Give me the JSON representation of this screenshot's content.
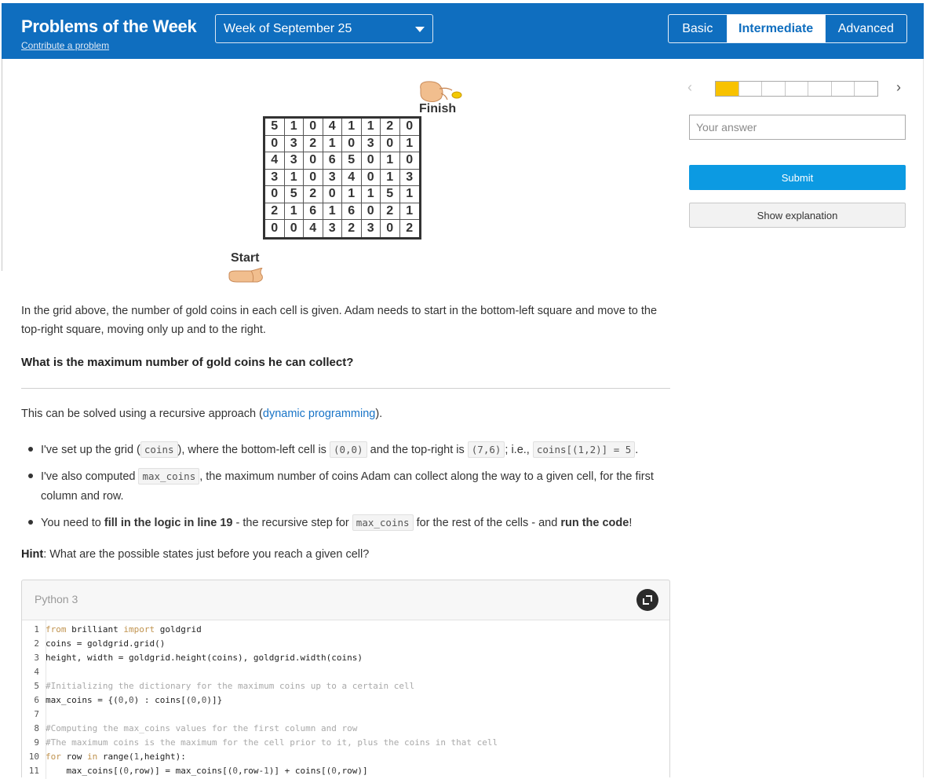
{
  "header": {
    "title": "Problems of the Week",
    "contribute_link": "Contribute a problem",
    "week_selected": "Week of September 25",
    "levels": [
      "Basic",
      "Intermediate",
      "Advanced"
    ],
    "active_level": "Intermediate",
    "colors": {
      "bar": "#0f6ebf",
      "active_tab_text": "#0f6ebf"
    }
  },
  "figure": {
    "finish_label": "Finish",
    "start_label": "Start",
    "grid": [
      [
        "5",
        "1",
        "0",
        "4",
        "1",
        "1",
        "2",
        "0"
      ],
      [
        "0",
        "3",
        "2",
        "1",
        "0",
        "3",
        "0",
        "1"
      ],
      [
        "4",
        "3",
        "0",
        "6",
        "5",
        "0",
        "1",
        "0"
      ],
      [
        "3",
        "1",
        "0",
        "3",
        "4",
        "0",
        "1",
        "3"
      ],
      [
        "0",
        "5",
        "2",
        "0",
        "1",
        "1",
        "5",
        "1"
      ],
      [
        "2",
        "1",
        "6",
        "1",
        "6",
        "0",
        "2",
        "1"
      ],
      [
        "0",
        "0",
        "4",
        "3",
        "2",
        "3",
        "0",
        "2"
      ]
    ]
  },
  "problem": {
    "text": "In the grid above, the number of gold coins in each cell is given. Adam needs to start in the bottom-left square and move to the top-right square, moving only up and to the right.",
    "question": "What is the maximum number of gold coins he can collect?"
  },
  "explanation": {
    "intro_before": "This can be solved using a recursive approach (",
    "intro_link": "dynamic programming",
    "intro_after": ").",
    "b1": {
      "t1": "I've set up the grid (",
      "c1": "coins",
      "t2": "), where the bottom-left cell is",
      "c2": "(0,0)",
      "t3": "and the top-right is",
      "c3": "(7,6)",
      "t4": "; i.e.,",
      "c4": "coins[(1,2)] = 5",
      "t5": "."
    },
    "b2": {
      "t1": "I've also computed",
      "c1": "max_coins",
      "t2": ", the maximum number of coins Adam can collect along the way to a given cell, for the first column and row."
    },
    "b3": {
      "t1": "You need to",
      "bold1": "fill in the logic in line 19",
      "t2": "- the recursive step for",
      "c1": "max_coins",
      "t3": "for the rest of the cells - and",
      "bold2": "run the code",
      "t4": "!"
    },
    "hint_label": "Hint",
    "hint_text": ": What are the possible states just before you reach a given cell?"
  },
  "editor": {
    "language": "Python 3",
    "lines": [
      {
        "n": "1",
        "parts": [
          [
            "kw",
            "from"
          ],
          [
            "tx",
            " brilliant "
          ],
          [
            "kw",
            "import"
          ],
          [
            "tx",
            " goldgrid"
          ]
        ]
      },
      {
        "n": "2",
        "parts": [
          [
            "tx",
            "coins = goldgrid.grid()"
          ]
        ]
      },
      {
        "n": "3",
        "parts": [
          [
            "tx",
            "height, width = goldgrid.height(coins), goldgrid.width(coins)"
          ]
        ]
      },
      {
        "n": "4",
        "parts": []
      },
      {
        "n": "5",
        "parts": [
          [
            "cm",
            "#Initializing the dictionary for the maximum coins up to a certain cell"
          ]
        ]
      },
      {
        "n": "6",
        "parts": [
          [
            "tx",
            "max_coins = {("
          ],
          [
            "nm",
            "0"
          ],
          [
            "tx",
            ","
          ],
          [
            "nm",
            "0"
          ],
          [
            "tx",
            ") : coins[("
          ],
          [
            "nm",
            "0"
          ],
          [
            "tx",
            ","
          ],
          [
            "nm",
            "0"
          ],
          [
            "tx",
            ")]}"
          ]
        ]
      },
      {
        "n": "7",
        "parts": []
      },
      {
        "n": "8",
        "parts": [
          [
            "cm",
            "#Computing the max_coins values for the first column and row"
          ]
        ]
      },
      {
        "n": "9",
        "parts": [
          [
            "cm",
            "#The maximum coins is the maximum for the cell prior to it, plus the coins in that cell"
          ]
        ]
      },
      {
        "n": "10",
        "parts": [
          [
            "kw",
            "for"
          ],
          [
            "tx",
            " row "
          ],
          [
            "kw",
            "in"
          ],
          [
            "tx",
            " range("
          ],
          [
            "nm",
            "1"
          ],
          [
            "tx",
            ",height):"
          ]
        ]
      },
      {
        "n": "11",
        "parts": [
          [
            "tx",
            "    max_coins[("
          ],
          [
            "nm",
            "0"
          ],
          [
            "tx",
            ",row)] = max_coins[("
          ],
          [
            "nm",
            "0"
          ],
          [
            "tx",
            ",row-"
          ],
          [
            "nm",
            "1"
          ],
          [
            "tx",
            ")] + coins[("
          ],
          [
            "nm",
            "0"
          ],
          [
            "tx",
            ",row)]"
          ]
        ]
      }
    ]
  },
  "sidebar": {
    "progress_segments": 7,
    "progress_filled": 1,
    "answer_placeholder": "Your answer",
    "answer_value": "",
    "submit_label": "Submit",
    "explanation_label": "Show explanation",
    "prev_glyph": "‹",
    "next_glyph": "›",
    "accent": "#0c9ae2",
    "progress_color": "#f8c200"
  }
}
